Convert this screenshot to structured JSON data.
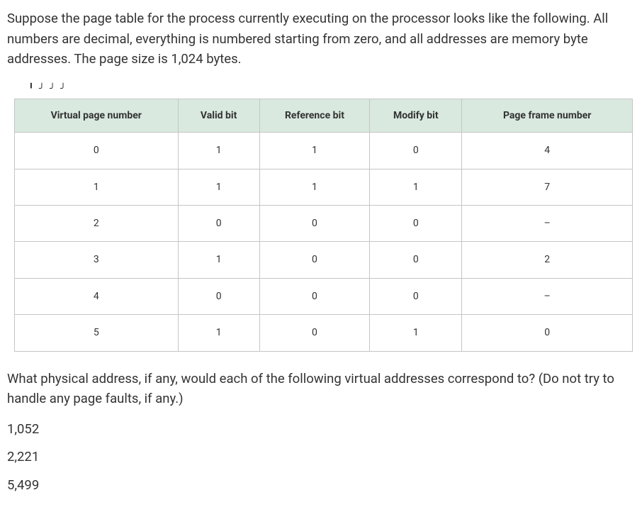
{
  "intro": "Suppose the page table for the process currently executing on the processor looks like the following. All numbers are decimal, everything is numbered starting from zero, and all addresses are memory byte addresses. The page size is 1,024 bytes.",
  "headers": {
    "vpn": "Virtual page number",
    "valid": "Valid bit",
    "ref": "Reference bit",
    "mod": "Modify bit",
    "frame": "Page frame number"
  },
  "rows": [
    {
      "vpn": "0",
      "valid": "1",
      "ref": "1",
      "mod": "0",
      "frame": "4"
    },
    {
      "vpn": "1",
      "valid": "1",
      "ref": "1",
      "mod": "1",
      "frame": "7"
    },
    {
      "vpn": "2",
      "valid": "0",
      "ref": "0",
      "mod": "0",
      "frame": "–"
    },
    {
      "vpn": "3",
      "valid": "1",
      "ref": "0",
      "mod": "0",
      "frame": "2"
    },
    {
      "vpn": "4",
      "valid": "0",
      "ref": "0",
      "mod": "0",
      "frame": "–"
    },
    {
      "vpn": "5",
      "valid": "1",
      "ref": "0",
      "mod": "1",
      "frame": "0"
    }
  ],
  "question": "What physical address, if any, would each of the following virtual addresses correspond to? (Do not try to handle any page faults, if any.)",
  "addresses": [
    "1,052",
    "2,221",
    "5,499"
  ]
}
